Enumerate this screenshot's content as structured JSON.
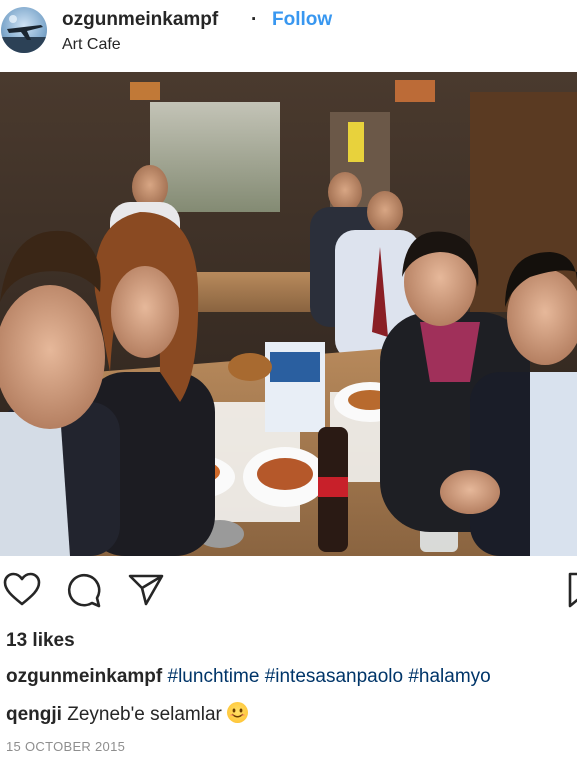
{
  "post": {
    "username": "ozgunmeinkampf",
    "separator": "·",
    "follow_label": "Follow",
    "location": "Art Cafe",
    "likes": "13 likes",
    "caption": {
      "username": "ozgunmeinkampf",
      "hashtags": [
        "#lunchtime",
        "#intesasanpaolo",
        "#halamyo"
      ]
    },
    "comment": {
      "username": "qengji",
      "text": "Zeyneb'e selamlar"
    },
    "date": "15 OCTOBER 2015"
  },
  "icons": {
    "like": "heart-icon",
    "comment": "comment-icon",
    "share": "share-icon",
    "save": "bookmark-icon",
    "emoji": "smiling-face-emoji"
  },
  "colors": {
    "link": "#3897f0",
    "hashtag": "#003569",
    "text": "#262626",
    "muted": "#8e8e8e"
  }
}
